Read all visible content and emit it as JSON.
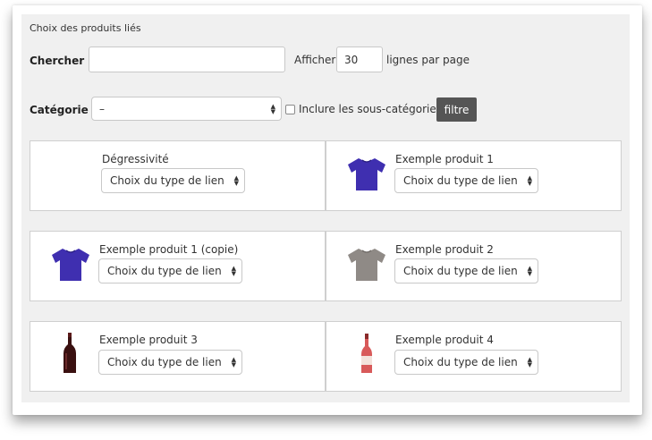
{
  "section_title": "Choix des produits liés",
  "search": {
    "label": "Chercher :",
    "value": "",
    "show_label": "Afficher",
    "rows_value": "30",
    "rows_suffix": "lignes par page"
  },
  "category": {
    "label": "Catégorie :",
    "selected": "–",
    "include_sub_label": "Inclure les sous-catégories",
    "include_sub_checked": false,
    "filter_button": "filtre"
  },
  "products": [
    {
      "name": "Dégressivité",
      "thumb": "none",
      "link_type": "Choix du type de lien"
    },
    {
      "name": "Exemple produit 1",
      "thumb": "tshirt-blue-icon",
      "link_type": "Choix du type de lien"
    },
    {
      "name": "Exemple produit 1 (copie)",
      "thumb": "tshirt-blue-icon",
      "link_type": "Choix du type de lien"
    },
    {
      "name": "Exemple produit 2",
      "thumb": "tshirt-grey-icon",
      "link_type": "Choix du type de lien"
    },
    {
      "name": "Exemple produit 3",
      "thumb": "bottle-red-wine-icon",
      "link_type": "Choix du type de lien"
    },
    {
      "name": "Exemple produit 4",
      "thumb": "bottle-rose-wine-icon",
      "link_type": "Choix du type de lien"
    }
  ],
  "colors": {
    "panel_bg": "#f0f0f0",
    "button_bg": "#555555",
    "tshirt_blue": "#3f2fb0",
    "tshirt_grey": "#8f8a86",
    "bottle_red": "#3a1010",
    "bottle_rose": "#d85a5a"
  }
}
